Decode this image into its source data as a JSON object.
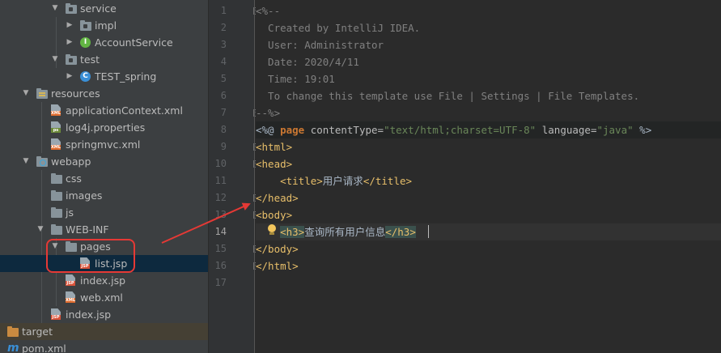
{
  "tree": {
    "items": [
      {
        "id": "service",
        "label": "service"
      },
      {
        "id": "impl",
        "label": "impl"
      },
      {
        "id": "account-service",
        "label": "AccountService"
      },
      {
        "id": "test",
        "label": "test"
      },
      {
        "id": "test-spring",
        "label": "TEST_spring"
      },
      {
        "id": "resources",
        "label": "resources"
      },
      {
        "id": "application-context",
        "label": "applicationContext.xml"
      },
      {
        "id": "log4j",
        "label": "log4j.properties"
      },
      {
        "id": "springmvc",
        "label": "springmvc.xml"
      },
      {
        "id": "webapp",
        "label": "webapp"
      },
      {
        "id": "css",
        "label": "css"
      },
      {
        "id": "images",
        "label": "images"
      },
      {
        "id": "js",
        "label": "js"
      },
      {
        "id": "web-inf",
        "label": "WEB-INF"
      },
      {
        "id": "pages",
        "label": "pages"
      },
      {
        "id": "list-jsp",
        "label": "list.jsp"
      },
      {
        "id": "index-jsp-inner",
        "label": "index.jsp"
      },
      {
        "id": "web-xml",
        "label": "web.xml"
      },
      {
        "id": "index-jsp",
        "label": "index.jsp"
      },
      {
        "id": "target",
        "label": "target"
      },
      {
        "id": "pom",
        "label": "pom.xml"
      }
    ],
    "icon_letters": {
      "interface": "I",
      "class": "C",
      "jsp": "JSP",
      "xml": "XML",
      "props": "ps"
    }
  },
  "editor": {
    "line_numbers": [
      "1",
      "2",
      "3",
      "4",
      "5",
      "6",
      "7",
      "8",
      "9",
      "10",
      "11",
      "12",
      "13",
      "14",
      "15",
      "16",
      "17"
    ],
    "active_line": "14",
    "lines": {
      "l1": "<%--",
      "l2": "  Created by IntelliJ IDEA.",
      "l3": "  User: Administrator",
      "l4": "  Date: 2020/4/11",
      "l5": "  Time: 19:01",
      "l6": "  To change this template use File | Settings | File Templates.",
      "l7": "--%>",
      "l8": {
        "open": "<%@ ",
        "directive": "page",
        "attr1": " contentType=",
        "val1": "\"text/html;charset=UTF-8\"",
        "attr2": " language=",
        "val2": "\"java\"",
        "close": " %>"
      },
      "l9": "<html>",
      "l10": "<head>",
      "l11": {
        "indent": "    ",
        "open": "<title>",
        "text": "用户请求",
        "close": "</title>"
      },
      "l12": "</head>",
      "l13": "<body>",
      "l14": {
        "indent": "    ",
        "open": "<h3>",
        "text": "查询所有用户信息",
        "close": "</h3>"
      },
      "l15": "</body>",
      "l16": "</html>",
      "l17": ""
    }
  },
  "colors": {
    "annotation": "#e53935",
    "selection": "#0d293e",
    "comment": "#808080",
    "tag": "#e8bf6a",
    "string": "#6a8759"
  }
}
